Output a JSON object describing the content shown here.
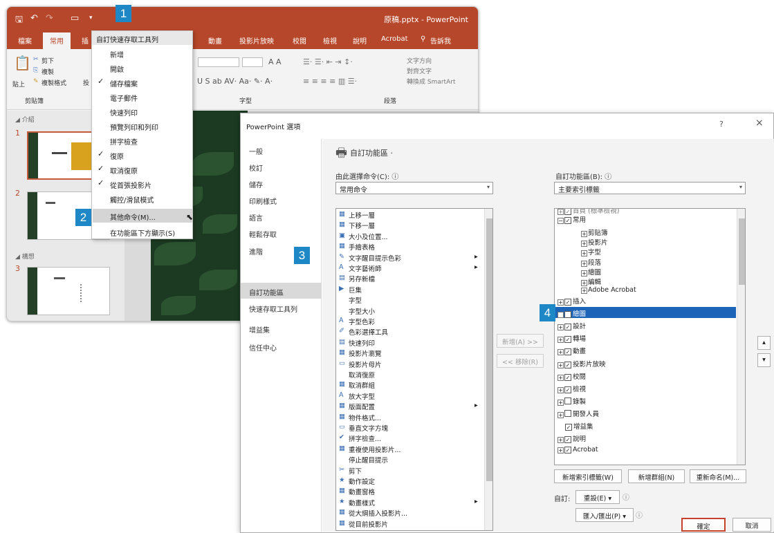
{
  "ppt": {
    "filename_title": "原稿.pptx - PowerPoint",
    "tabs": [
      "檔案",
      "常用",
      "插",
      "動畫",
      "投影片放映",
      "校閱",
      "檢視",
      "說明",
      "Acrobat",
      "告訴我"
    ],
    "ribbon": {
      "cut": "剪下",
      "copy": "複製",
      "paste": "貼上",
      "format_painter": "複製格式",
      "slide_group": "投",
      "clipboard_group": "剪貼簿",
      "font_group": "字型",
      "paragraph_group": "段落",
      "text_direction": "文字方向",
      "align_text": "對齊文字",
      "smartart": "轉換成 SmartArt"
    },
    "sections": [
      "介紹",
      "構想"
    ],
    "slide_numbers": [
      "1",
      "2",
      "3"
    ]
  },
  "qat_menu": {
    "header": "自訂快速存取工具列",
    "items": [
      {
        "label": "新增",
        "checked": false
      },
      {
        "label": "開啟",
        "checked": false
      },
      {
        "label": "儲存檔案",
        "checked": true
      },
      {
        "label": "電子郵件",
        "checked": false
      },
      {
        "label": "快速列印",
        "checked": false
      },
      {
        "label": "預覽列印和列印",
        "checked": false
      },
      {
        "label": "拼字檢查",
        "checked": false
      },
      {
        "label": "復原",
        "checked": true
      },
      {
        "label": "取消復原",
        "checked": true
      },
      {
        "label": "從首張投影片",
        "checked": true
      },
      {
        "label": "觸控/滑鼠模式",
        "checked": false
      },
      {
        "label": "其他命令(M)...",
        "checked": false
      },
      {
        "label": "在功能區下方顯示(S)",
        "checked": false
      }
    ]
  },
  "badges": [
    "1",
    "2",
    "3",
    "4"
  ],
  "dialog": {
    "title": "PowerPoint 選項",
    "help": "?",
    "close": "×",
    "nav": [
      "一般",
      "校訂",
      "儲存",
      "印刷樣式",
      "語言",
      "輕鬆存取",
      "進階",
      "自訂功能區",
      "快速存取工具列",
      "增益集",
      "信任中心"
    ],
    "section_title": "自訂功能區",
    "choose_label": "由此選擇命令(C):",
    "choose_value": "常用命令",
    "customize_label": "自訂功能區(B):",
    "customize_value": "主要索引標籤",
    "commands": [
      "上移一層",
      "下移一層",
      "大小及位置...",
      "手繪表格",
      "文字醒目提示色彩",
      "文字藝術師",
      "另存新檔",
      "巨集",
      "字型",
      "字型大小",
      "字型色彩",
      "色彩選擇工具",
      "快速列印",
      "投影片瀏覽",
      "投影片母片",
      "取消復原",
      "取消群組",
      "放大字型",
      "版面配置",
      "物件格式...",
      "垂直文字方塊",
      "拼字檢查...",
      "重複使用投影片...",
      "停止醒目提示",
      "剪下",
      "動作設定",
      "動畫窗格",
      "動畫樣式",
      "從大綱插入投影片...",
      "從目前投影片"
    ],
    "add_button": "新增(A) >>",
    "remove_button": "<< 移除(R)",
    "tree": {
      "partial_top": "首頁 (標準檢視)",
      "home": "常用",
      "home_groups": [
        "剪貼簿",
        "投影片",
        "字型",
        "段落",
        "繪圖",
        "編輯",
        "Adobe Acrobat"
      ],
      "tabs": [
        {
          "label": "插入",
          "checked": true
        },
        {
          "label": "繪圖",
          "checked": true
        },
        {
          "label": "設計",
          "checked": true
        },
        {
          "label": "轉場",
          "checked": true
        },
        {
          "label": "動畫",
          "checked": true
        },
        {
          "label": "投影片放映",
          "checked": true
        },
        {
          "label": "校閱",
          "checked": true
        },
        {
          "label": "檢視",
          "checked": true
        },
        {
          "label": "錄製",
          "checked": false
        },
        {
          "label": "開發人員",
          "checked": false
        },
        {
          "label": "增益集",
          "checked": true
        },
        {
          "label": "說明",
          "checked": true
        },
        {
          "label": "Acrobat",
          "checked": true
        }
      ]
    },
    "new_tab_button": "新增索引標籤(W)",
    "new_group_button": "新增群組(N)",
    "rename_button": "重新命名(M)...",
    "customize_label2": "自訂:",
    "reset_button": "重設(E) ▾",
    "import_export_button": "匯入/匯出(P) ▾",
    "ok_button": "確定",
    "cancel_button": "取消"
  }
}
